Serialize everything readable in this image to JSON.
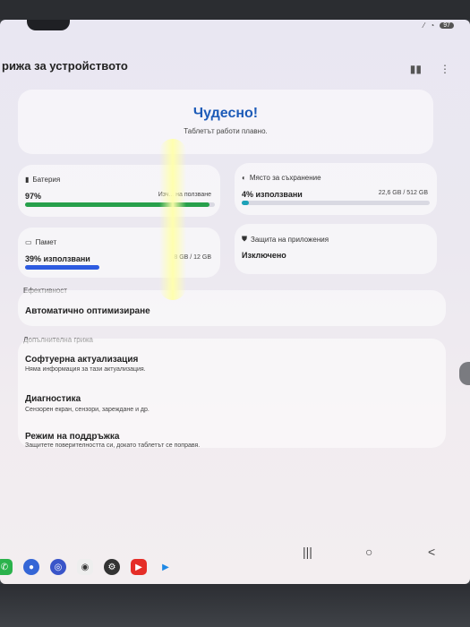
{
  "status": {
    "battery": "97"
  },
  "header": {
    "title": "рижа за устройството"
  },
  "hero": {
    "title": "Чудесно!",
    "subtitle": "Таблетът работи плавно."
  },
  "battery": {
    "label": "Батерия",
    "value": "97%",
    "extra": "Изч... на ползване",
    "percent": 97,
    "color": "#27a04b"
  },
  "storage": {
    "label": "Място за съхранение",
    "value": "4% използвани",
    "extra": "22,6 GB / 512 GB",
    "percent": 4,
    "color": "#1ea2b8"
  },
  "memory": {
    "label": "Памет",
    "value": "39% използвани",
    "extra": "8 GB / 12 GB",
    "percent": 39,
    "color": "#2d5be0"
  },
  "protection": {
    "label": "Защита на приложения",
    "value": "Изключено"
  },
  "sections": {
    "performance": "Ефективност",
    "additional": "Допълнителна грижа"
  },
  "items": [
    {
      "title": "Автоматично оптимизиране",
      "subtitle": ""
    },
    {
      "title": "Софтуерна актуализация",
      "subtitle": "Няма информация за тази актуализация."
    },
    {
      "title": "Диагностика",
      "subtitle": "Сензорен екран, сензори, зареждане и др."
    },
    {
      "title": "Режим на поддръжка",
      "subtitle": "Защитете поверителността си, докато таблетът се поправя."
    }
  ],
  "nav": {
    "recents": "|||",
    "home": "○",
    "back": "<"
  },
  "icons": [
    "phone-icon",
    "messages-icon",
    "browser-icon",
    "camera-icon",
    "settings-icon",
    "youtube-icon",
    "play-store-icon"
  ]
}
